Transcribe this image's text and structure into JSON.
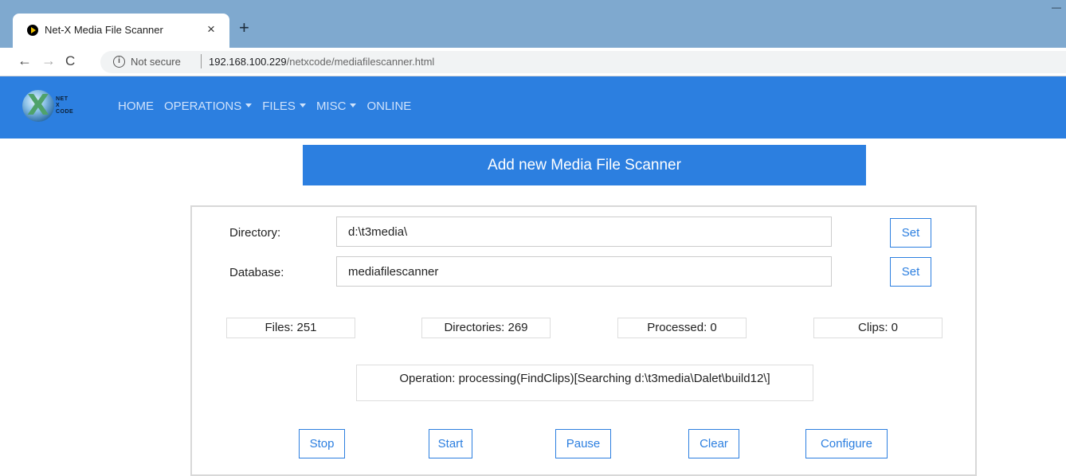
{
  "browser": {
    "tab_title": "Net-X Media File Scanner",
    "tab_close": "×",
    "new_tab": "+",
    "window_min": "—",
    "nav_back": "←",
    "nav_forward": "→",
    "nav_reload": "C",
    "info_glyph": "i",
    "security_label": "Not secure",
    "url_host": "192.168.100.229",
    "url_path": "/netxcode/mediafilescanner.html"
  },
  "navbar": {
    "logo_text_1": "NET",
    "logo_text_2": "X",
    "logo_text_3": "CODE",
    "logo_x": "X",
    "items": [
      {
        "label": "HOME",
        "dropdown": false
      },
      {
        "label": "OPERATIONS",
        "dropdown": true
      },
      {
        "label": "FILES",
        "dropdown": true
      },
      {
        "label": "MISC",
        "dropdown": true
      },
      {
        "label": "ONLINE",
        "dropdown": false
      }
    ],
    "colors": {
      "background": "#2c7fe0",
      "text": "#cfe2fb"
    }
  },
  "banner": {
    "title": "Add new Media File Scanner"
  },
  "form": {
    "directory_label": "Directory:",
    "directory_value": "d:\\t3media\\",
    "database_label": "Database:",
    "database_value": "mediafilescanner",
    "set_label": "Set"
  },
  "stats": {
    "files": "Files:  251",
    "directories": "Directories:  269",
    "processed": "Processed:  0",
    "clips": "Clips:  0"
  },
  "operation": {
    "text": "Operation: processing(FindClips)[Searching d:\\t3media\\Dalet\\build12\\]"
  },
  "actions": {
    "stop": "Stop",
    "start": "Start",
    "pause": "Pause",
    "clear": "Clear",
    "configure": "Configure"
  },
  "colors": {
    "accent": "#2c7fe0",
    "tabstrip": "#7fa9cf"
  }
}
